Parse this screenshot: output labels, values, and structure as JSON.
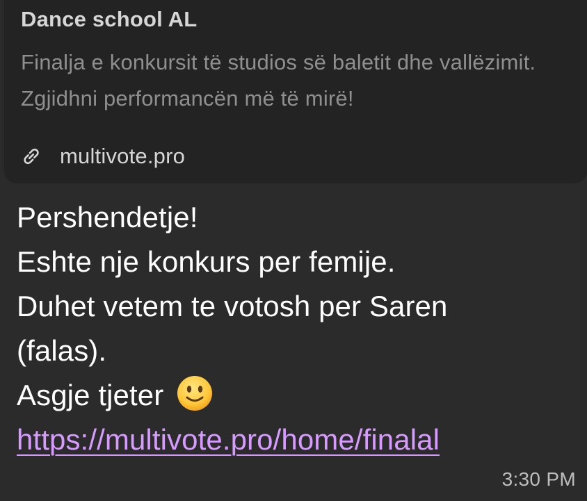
{
  "link_preview": {
    "site_name": "Dance school AL",
    "description": "Finalja e konkursit të studios së baletit dhe vallëzimit. Zgjidhni performancën më të mirë!",
    "domain": "multivote.pro",
    "icon": "link-icon"
  },
  "message": {
    "lines": [
      "Pershendetje!",
      "Eshte nje konkurs per femije.",
      "Duhet vetem te votosh per Saren",
      "(falas).",
      "Asgje tjeter"
    ],
    "emoji_icon": "slightly-smiling-face-icon",
    "url": "https://multivote.pro/home/finalal",
    "time": "3:30 PM"
  },
  "colors": {
    "background": "#2b2b2b",
    "card": "#232323",
    "link": "#d79bff",
    "muted_text": "#8f8f8f",
    "timestamp": "#bdbdbd"
  }
}
